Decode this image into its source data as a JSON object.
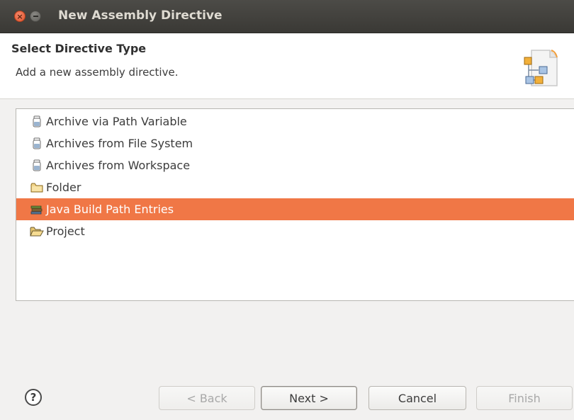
{
  "window": {
    "title": "New Assembly Directive"
  },
  "header": {
    "title": "Select Directive Type",
    "description": "Add a new assembly directive."
  },
  "list": {
    "items": [
      {
        "label": "Archive via Path Variable",
        "icon": "jar-icon"
      },
      {
        "label": "Archives from File System",
        "icon": "jar-icon"
      },
      {
        "label": "Archives from Workspace",
        "icon": "jar-icon"
      },
      {
        "label": "Folder",
        "icon": "folder-icon"
      },
      {
        "label": "Java Build Path Entries",
        "icon": "library-icon",
        "selected": true
      },
      {
        "label": "Project",
        "icon": "open-folder-icon"
      }
    ]
  },
  "buttons": {
    "help": "?",
    "back": "< Back",
    "next": "Next >",
    "cancel": "Cancel",
    "finish": "Finish"
  },
  "colors": {
    "selection": "#f07746",
    "titlebar": "#3c3b37"
  }
}
